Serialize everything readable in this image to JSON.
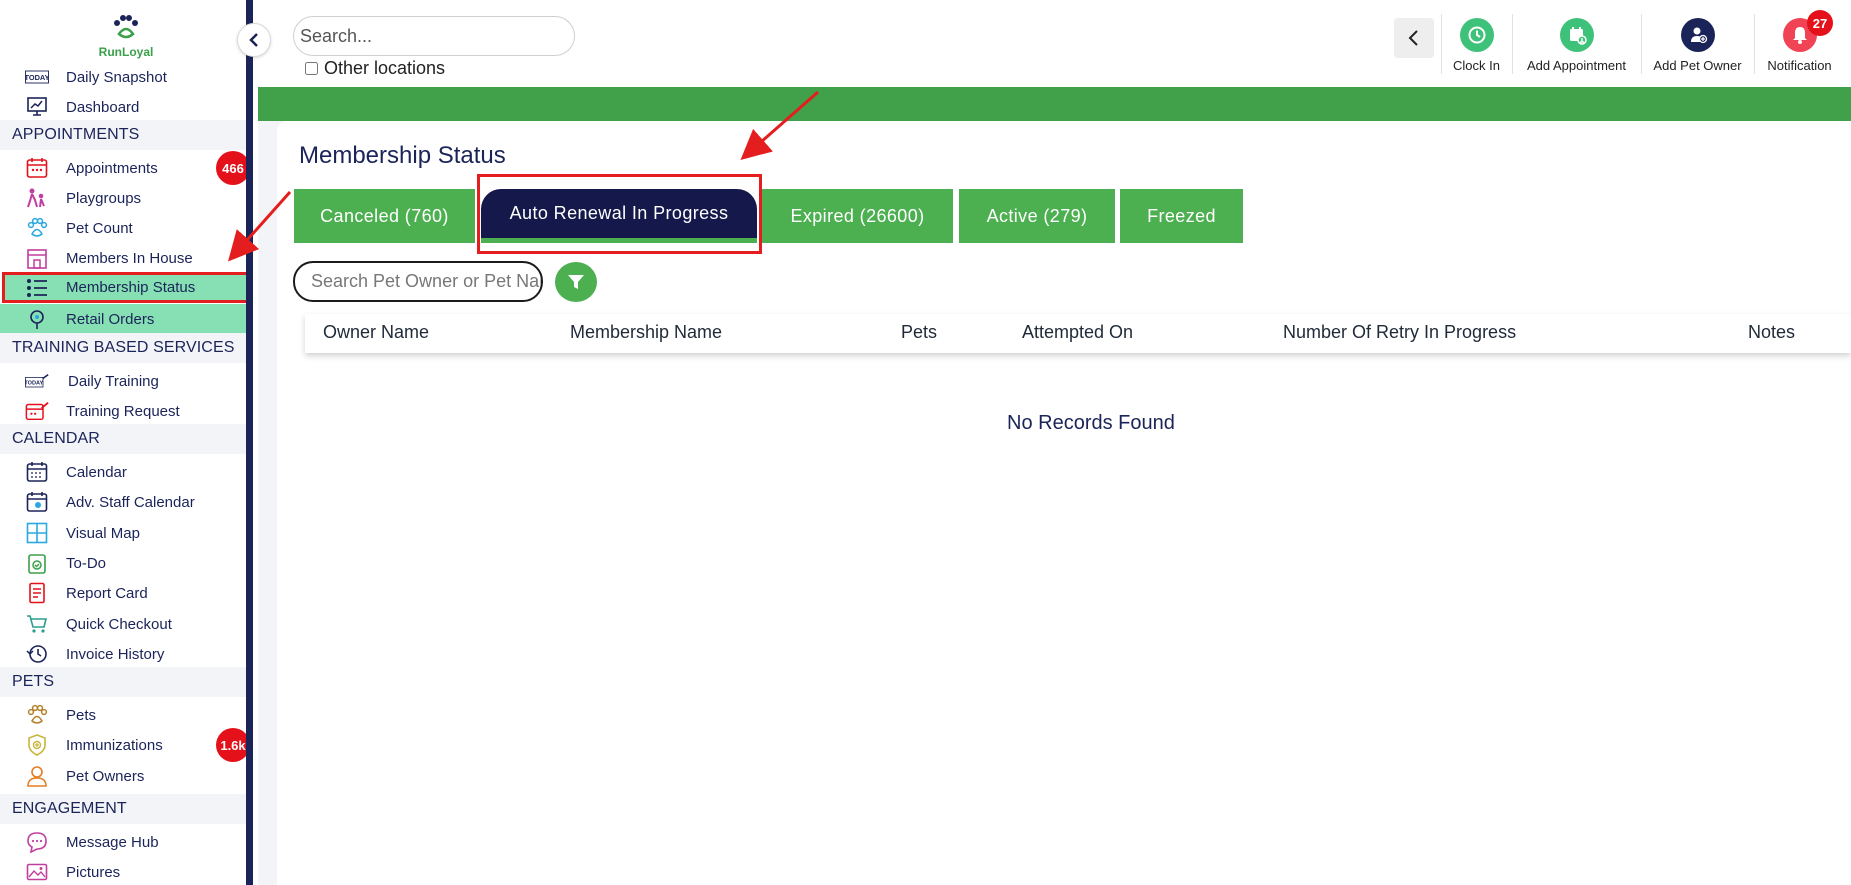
{
  "brand": {
    "name": "RunLoyal"
  },
  "sidebar": {
    "items": [
      {
        "label": "Daily Snapshot",
        "icon": "today-icon",
        "color": "#1b2459"
      },
      {
        "label": "Dashboard",
        "icon": "dashboard-icon",
        "color": "#1b2459"
      },
      {
        "section": "APPOINTMENTS"
      },
      {
        "label": "Appointments",
        "icon": "appointments-icon",
        "color": "#e4111b",
        "badge": "466"
      },
      {
        "label": "Playgroups",
        "icon": "playgroups-icon",
        "color": "#c13ea0"
      },
      {
        "label": "Pet Count",
        "icon": "paw-icon",
        "color": "#2aa9e0"
      },
      {
        "label": "Members In House",
        "icon": "house-icon",
        "color": "#c13ea0"
      },
      {
        "label": "Membership Status",
        "icon": "membership-list-icon",
        "color": "#1b2459"
      },
      {
        "label": "Retail Orders",
        "icon": "retail-icon",
        "color": "#1b2459"
      },
      {
        "section": "TRAINING BASED SERVICES"
      },
      {
        "label": "Daily Training",
        "icon": "training-icon",
        "color": "#1b2459"
      },
      {
        "label": "Training Request",
        "icon": "training-request-icon",
        "color": "#e4111b"
      },
      {
        "section": "CALENDAR"
      },
      {
        "label": "Calendar",
        "icon": "calendar-icon",
        "color": "#1b2459"
      },
      {
        "label": "Adv. Staff Calendar",
        "icon": "staff-calendar-icon",
        "color": "#1b2459"
      },
      {
        "label": "Visual Map",
        "icon": "visual-map-icon",
        "color": "#2aa9e0"
      },
      {
        "label": "To-Do",
        "icon": "todo-icon",
        "color": "#3aa04a"
      },
      {
        "label": "Report Card",
        "icon": "report-card-icon",
        "color": "#e4111b"
      },
      {
        "label": "Quick Checkout",
        "icon": "cart-icon",
        "color": "#2a9d8f"
      },
      {
        "label": "Invoice History",
        "icon": "invoice-history-icon",
        "color": "#1b2459"
      },
      {
        "section": "PETS"
      },
      {
        "label": "Pets",
        "icon": "pets-icon",
        "color": "#b5832e"
      },
      {
        "label": "Immunizations",
        "icon": "immunization-icon",
        "color": "#c8b53a",
        "badge": "1.6k"
      },
      {
        "label": "Pet Owners",
        "icon": "person-icon",
        "color": "#e67e22"
      },
      {
        "section": "ENGAGEMENT"
      },
      {
        "label": "Message Hub",
        "icon": "message-icon",
        "color": "#c13ea0"
      },
      {
        "label": "Pictures",
        "icon": "pictures-icon",
        "color": "#c13ea0"
      }
    ]
  },
  "topbar": {
    "search_placeholder": "Search...",
    "other_locations": "Other locations",
    "actions": [
      {
        "label": "Clock In",
        "icon": "clock-icon",
        "color": "#3ec27a"
      },
      {
        "label": "Add Appointment",
        "icon": "add-appointment-icon",
        "color": "#3ec27a"
      },
      {
        "label": "Add Pet Owner",
        "icon": "add-person-icon",
        "color": "#1b2459"
      },
      {
        "label": "Notification",
        "icon": "bell-icon",
        "color": "#f04456",
        "badge": "27"
      }
    ]
  },
  "main": {
    "title": "Membership Status",
    "tabs": [
      {
        "label": "Canceled (760)"
      },
      {
        "label": "Auto Renewal In Progress",
        "active": true
      },
      {
        "label": "Expired (26600)"
      },
      {
        "label": "Active (279)"
      },
      {
        "label": "Freezed"
      }
    ],
    "search_placeholder": "Search Pet Owner or Pet Name",
    "columns": [
      "Owner Name",
      "Membership Name",
      "Pets",
      "Attempted On",
      "Number Of Retry In Progress",
      "Notes"
    ],
    "empty_message": "No Records Found"
  },
  "colors": {
    "primary_navy": "#1b2459",
    "accent_green": "#4caf50",
    "active_row": "#86e0b3",
    "highlight_red": "#e41e1e",
    "badge_red": "#e4111b"
  }
}
